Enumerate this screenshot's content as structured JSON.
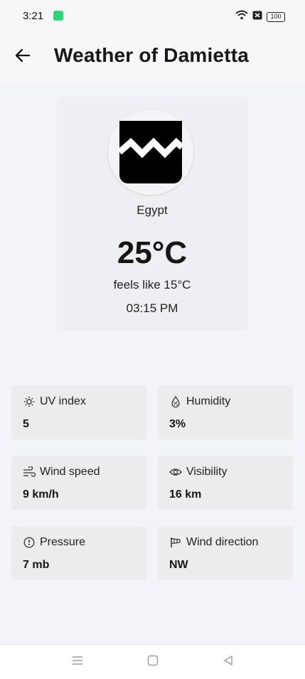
{
  "status_bar": {
    "time": "3:21",
    "battery": "100",
    "app_notification_icon": "green-app-icon",
    "wifi_icon": "wifi-icon",
    "sim_icon": "no-sim-icon"
  },
  "header": {
    "title": "Weather of Damietta",
    "back_icon": "arrow-left-icon"
  },
  "weather": {
    "icon": "weather-condition-icon",
    "country": "Egypt",
    "temperature": "25°C",
    "feels_like": "feels like 15°C",
    "time": "03:15 PM"
  },
  "details": [
    {
      "label": "UV index",
      "value": "5",
      "icon": "sun-icon"
    },
    {
      "label": "Humidity",
      "value": "3%",
      "icon": "humidity-icon"
    },
    {
      "label": "Wind speed",
      "value": "9 km/h",
      "icon": "wind-icon"
    },
    {
      "label": "Visibility",
      "value": "16 km",
      "icon": "eye-icon"
    },
    {
      "label": "Pressure",
      "value": "7 mb",
      "icon": "gauge-icon"
    },
    {
      "label": "Wind direction",
      "value": "NW",
      "icon": "windsock-icon"
    }
  ],
  "nav_bar": {
    "menu_icon": "menu-icon",
    "home_icon": "home-square-icon",
    "back_icon": "back-triangle-icon"
  },
  "colors": {
    "background": "#f3f4f7",
    "card": "#ececef",
    "text": "#1a1a1a",
    "status_app_icon": "#2ed47a"
  }
}
